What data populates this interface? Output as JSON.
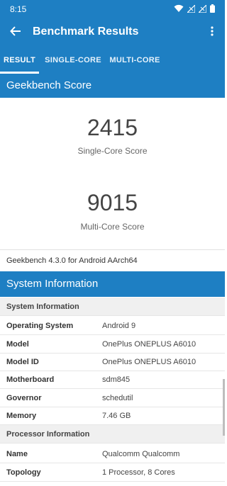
{
  "status": {
    "time": "8:15"
  },
  "appbar": {
    "title": "Benchmark Results"
  },
  "tabs": [
    {
      "label": "RESULT",
      "active": true
    },
    {
      "label": "SINGLE-CORE",
      "active": false
    },
    {
      "label": "MULTI-CORE",
      "active": false
    }
  ],
  "geekbench": {
    "header": "Geekbench Score",
    "single_score": "2415",
    "single_label": "Single-Core Score",
    "multi_score": "9015",
    "multi_label": "Multi-Core Score",
    "version": "Geekbench 4.3.0 for Android AArch64"
  },
  "system": {
    "header": "System Information",
    "rows": [
      {
        "key": "System Information",
        "value": "",
        "group": true
      },
      {
        "key": "Operating System",
        "value": "Android 9"
      },
      {
        "key": "Model",
        "value": "OnePlus ONEPLUS A6010"
      },
      {
        "key": "Model ID",
        "value": "OnePlus ONEPLUS A6010"
      },
      {
        "key": "Motherboard",
        "value": "sdm845"
      },
      {
        "key": "Governor",
        "value": "schedutil"
      },
      {
        "key": "Memory",
        "value": "7.46 GB"
      },
      {
        "key": "Processor Information",
        "value": "",
        "group": true
      },
      {
        "key": "Name",
        "value": "Qualcomm Qualcomm"
      },
      {
        "key": "Topology",
        "value": "1 Processor, 8 Cores"
      }
    ]
  }
}
